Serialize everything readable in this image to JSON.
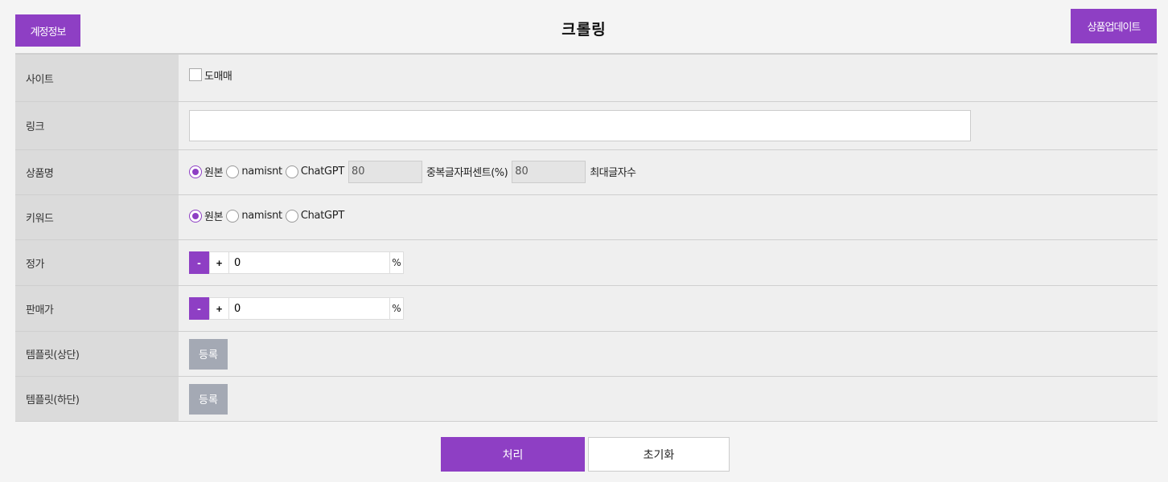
{
  "header": {
    "account_button": "계정정보",
    "title": "크롤링",
    "update_button": "상품업데이트"
  },
  "form": {
    "site": {
      "label": "사이트",
      "option": "도매매",
      "checked": false
    },
    "link": {
      "label": "링크",
      "value": "",
      "placeholder": ""
    },
    "product_name": {
      "label": "상품명",
      "options": [
        "원본",
        "namisnt",
        "ChatGPT"
      ],
      "selected": "원본",
      "duplicate_percent_value": "80",
      "duplicate_percent_label": "중복글자퍼센트(%)",
      "max_chars_value": "80",
      "max_chars_label": "최대글자수"
    },
    "keyword": {
      "label": "키워드",
      "options": [
        "원본",
        "namisnt",
        "ChatGPT"
      ],
      "selected": "원본"
    },
    "list_price": {
      "label": "정가",
      "minus": "-",
      "plus": "+",
      "value": "0",
      "unit": "%"
    },
    "sale_price": {
      "label": "판매가",
      "minus": "-",
      "plus": "+",
      "value": "0",
      "unit": "%"
    },
    "template_top": {
      "label": "템플릿(상단)",
      "button": "등록"
    },
    "template_bottom": {
      "label": "템플릿(하단)",
      "button": "등록"
    }
  },
  "footer": {
    "process_button": "처리",
    "reset_button": "초기화"
  },
  "colors": {
    "accent": "#8e3fc4",
    "label_bg": "#dbdbdb",
    "content_bg": "#efefef",
    "register_bg": "#a4a9b4"
  }
}
